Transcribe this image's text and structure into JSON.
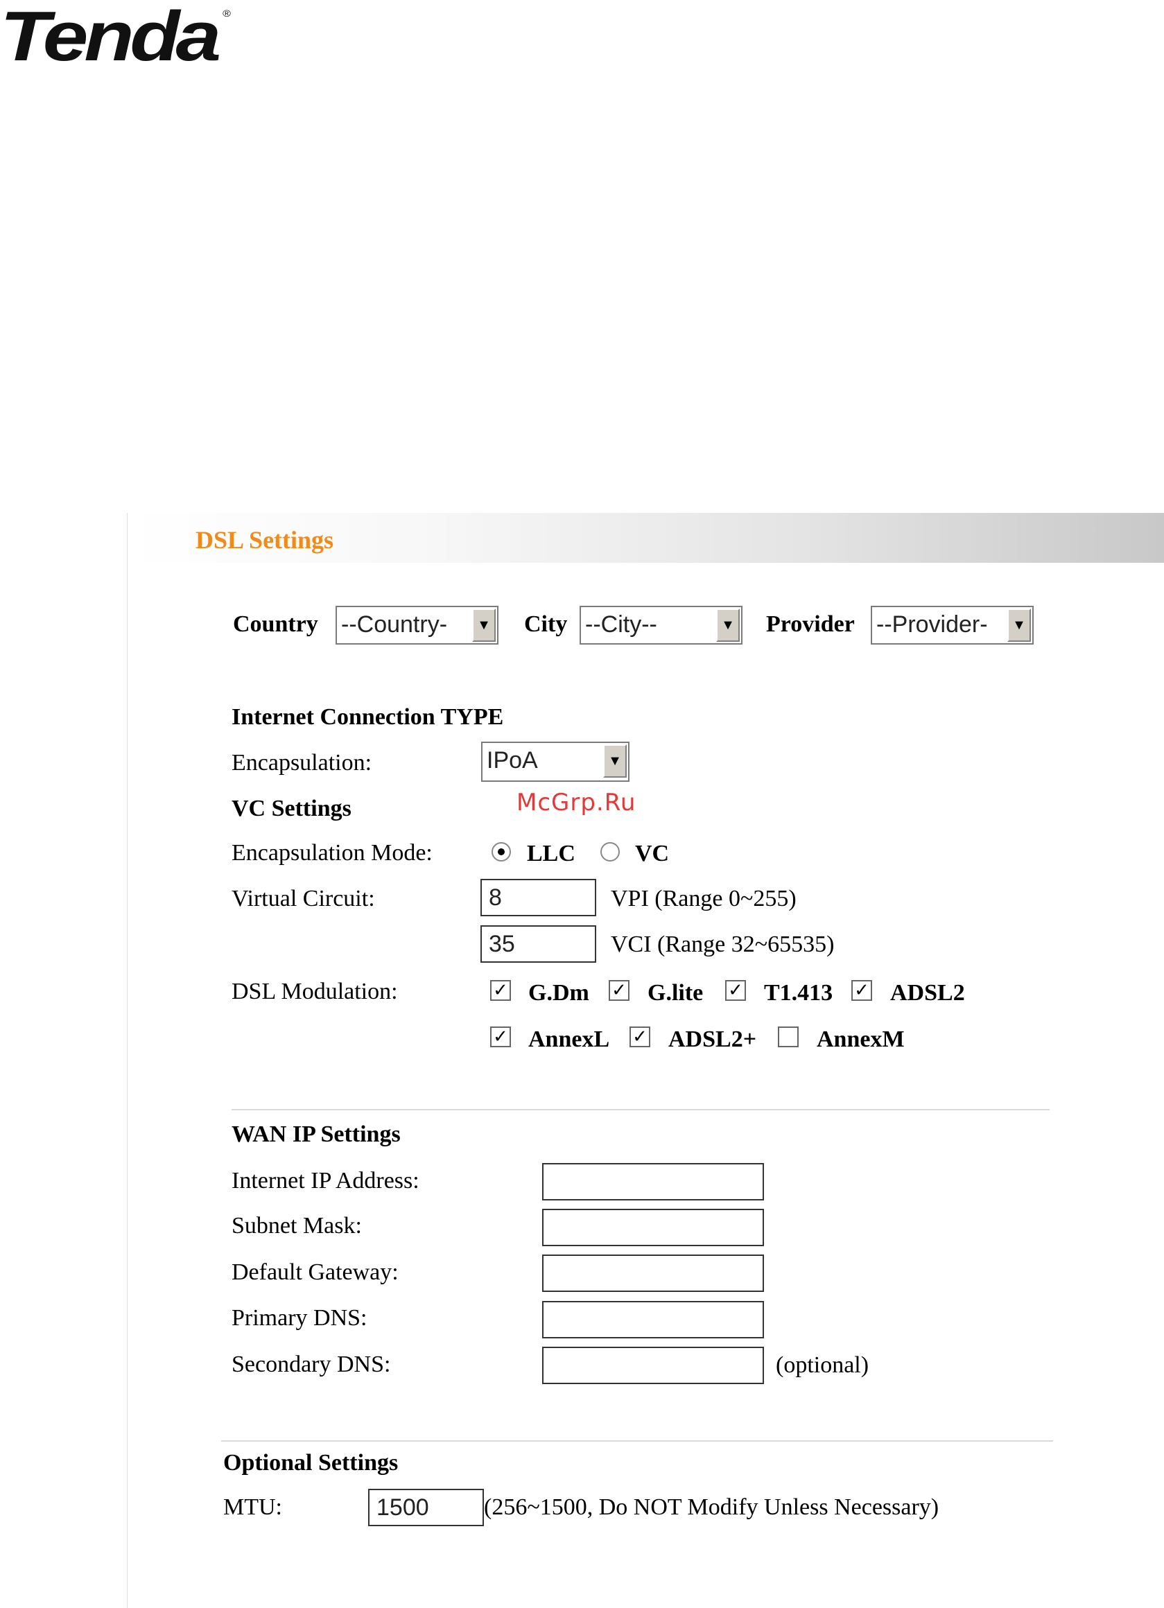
{
  "brand": {
    "logo_text": "Tenda",
    "logo_mark": "®"
  },
  "panel": {
    "title": "DSL Settings"
  },
  "location": {
    "country_label": "Country",
    "country_value": "--Country-",
    "city_label": "City",
    "city_value": "--City--",
    "provider_label": "Provider",
    "provider_value": "--Provider-"
  },
  "connection": {
    "heading": "Internet Connection TYPE",
    "encapsulation_label": "Encapsulation:",
    "encapsulation_value": "IPoA"
  },
  "watermark": "McGrp.Ru",
  "vc": {
    "heading": "VC Settings",
    "mode_label": "Encapsulation Mode:",
    "mode_options": [
      {
        "label": "LLC",
        "selected": true
      },
      {
        "label": "VC",
        "selected": false
      }
    ],
    "circuit_label": "Virtual Circuit:",
    "vpi_value": "8",
    "vpi_hint": "VPI (Range 0~255)",
    "vci_value": "35",
    "vci_hint": "VCI (Range 32~65535)"
  },
  "modulation": {
    "label": "DSL Modulation:",
    "options": [
      {
        "label": "G.Dm",
        "checked": true
      },
      {
        "label": "G.lite",
        "checked": true
      },
      {
        "label": "T1.413",
        "checked": true
      },
      {
        "label": "ADSL2",
        "checked": true
      },
      {
        "label": "AnnexL",
        "checked": true
      },
      {
        "label": "ADSL2+",
        "checked": true
      },
      {
        "label": "AnnexM",
        "checked": false
      }
    ]
  },
  "wan": {
    "heading": "WAN IP Settings",
    "fields": [
      {
        "label": "Internet IP Address:",
        "value": ""
      },
      {
        "label": "Subnet Mask:",
        "value": ""
      },
      {
        "label": "Default Gateway:",
        "value": ""
      },
      {
        "label": "Primary DNS:",
        "value": ""
      },
      {
        "label": "Secondary DNS:",
        "value": ""
      }
    ],
    "secondary_hint": "(optional)"
  },
  "optional": {
    "heading": "Optional Settings",
    "mtu_label": "MTU:",
    "mtu_value": "1500",
    "mtu_hint": "(256~1500, Do NOT Modify Unless Necessary)"
  }
}
